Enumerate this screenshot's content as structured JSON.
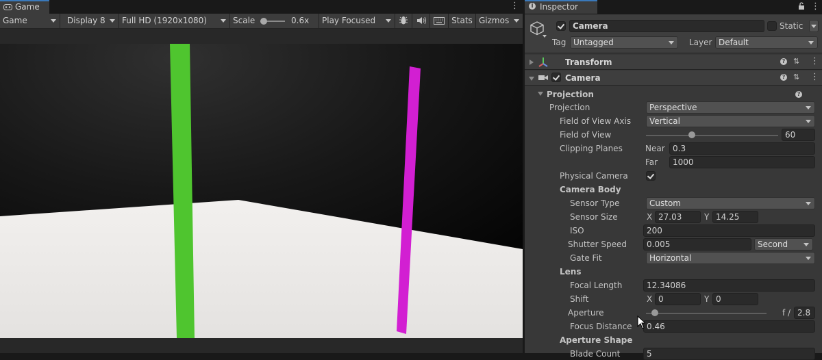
{
  "game": {
    "tab_label": "Game",
    "toolbar": {
      "view_mode": "Game",
      "display": "Display 8",
      "resolution": "Full HD (1920x1080)",
      "scale_label": "Scale",
      "scale_value": "0.6x",
      "play_mode": "Play Focused",
      "stats_label": "Stats",
      "gizmos_label": "Gizmos"
    }
  },
  "inspector": {
    "tab_label": "Inspector",
    "object_name": "Camera",
    "static_label": "Static",
    "tag_label": "Tag",
    "tag_value": "Untagged",
    "layer_label": "Layer",
    "layer_value": "Default",
    "components": {
      "transform_label": "Transform",
      "camera_label": "Camera"
    },
    "projection_section": "Projection",
    "fields": {
      "projection_label": "Projection",
      "projection_value": "Perspective",
      "fov_axis_label": "Field of View Axis",
      "fov_axis_value": "Vertical",
      "fov_label": "Field of View",
      "fov_value": "60",
      "clipping_label": "Clipping Planes",
      "near_label": "Near",
      "near_value": "0.3",
      "far_label": "Far",
      "far_value": "1000",
      "physical_camera_label": "Physical Camera",
      "camera_body_label": "Camera Body",
      "sensor_type_label": "Sensor Type",
      "sensor_type_value": "Custom",
      "sensor_size_label": "Sensor Size",
      "sensor_x_label": "X",
      "sensor_x_value": "27.03",
      "sensor_y_label": "Y",
      "sensor_y_value": "14.25",
      "iso_label": "ISO",
      "iso_value": "200",
      "shutter_label": "Shutter Speed",
      "shutter_value": "0.005",
      "shutter_unit": "Second",
      "gate_fit_label": "Gate Fit",
      "gate_fit_value": "Horizontal",
      "lens_label": "Lens",
      "focal_length_label": "Focal Length",
      "focal_length_value": "12.34086",
      "shift_label": "Shift",
      "shift_x_label": "X",
      "shift_x_value": "0",
      "shift_y_label": "Y",
      "shift_y_value": "0",
      "aperture_label": "Aperture",
      "aperture_prefix": "f /",
      "aperture_value": "2.8",
      "focus_distance_label": "Focus Distance",
      "focus_distance_value": "0.46",
      "aperture_shape_label": "Aperture Shape",
      "blade_count_label": "Blade Count",
      "blade_count_value": "5"
    }
  },
  "colors": {
    "green_pillar": "#4fc52f",
    "magenta_pillar": "#d21fd2",
    "floor": "#eae8e6",
    "accent": "#3a79bb"
  }
}
